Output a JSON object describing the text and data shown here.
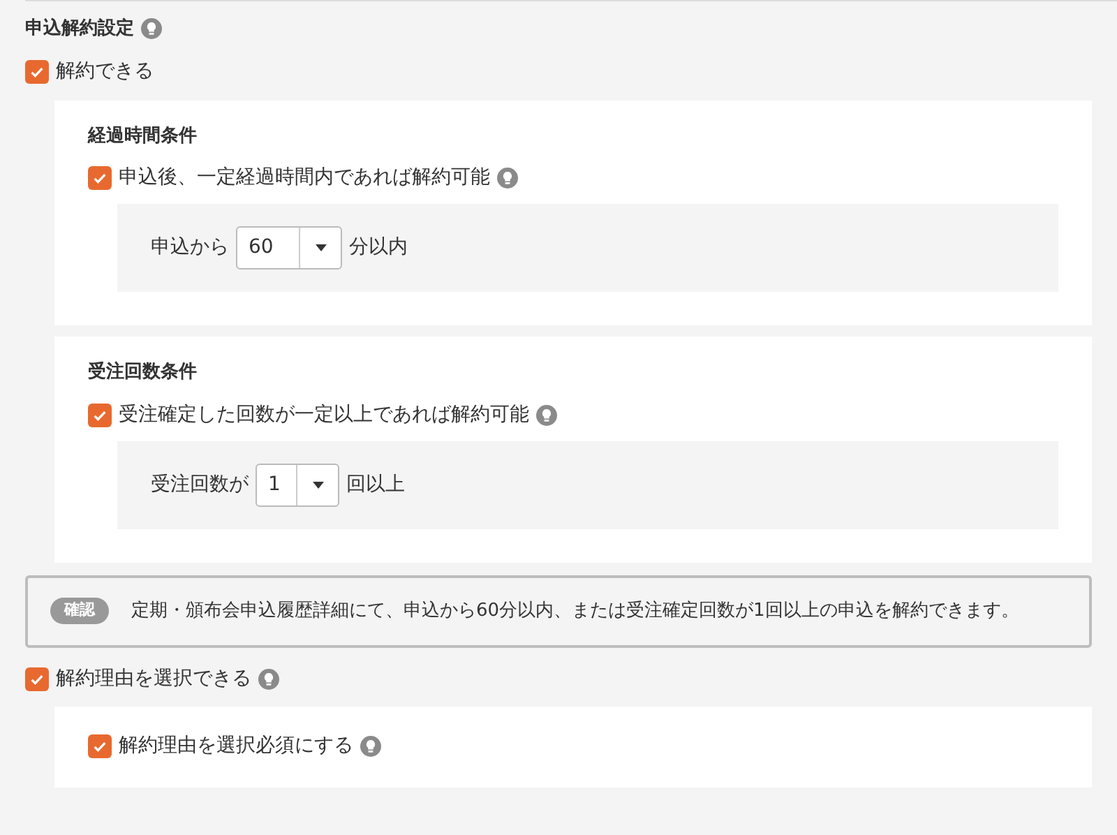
{
  "section": {
    "title": "申込解約設定"
  },
  "cancel_allowed": {
    "label": "解約できる",
    "checked": true
  },
  "conditions": [
    {
      "heading": "経過時間条件",
      "label": "申込後、一定経過時間内であれば解約可能",
      "checked": true,
      "prefix": "申込から",
      "value": "60",
      "suffix": "分以内"
    },
    {
      "heading": "受注回数条件",
      "label": "受注確定した回数が一定以上であれば解約可能",
      "checked": true,
      "prefix": "受注回数が",
      "value": "1",
      "suffix": "回以上"
    }
  ],
  "confirm": {
    "badge": "確認",
    "text": "定期・頒布会申込履歴詳細にて、申込から60分以内、または受注確定回数が1回以上の申込を解約できます。"
  },
  "reason_selectable": {
    "label": "解約理由を選択できる",
    "checked": true
  },
  "reason_required": {
    "label": "解約理由を選択必須にする",
    "checked": true
  }
}
